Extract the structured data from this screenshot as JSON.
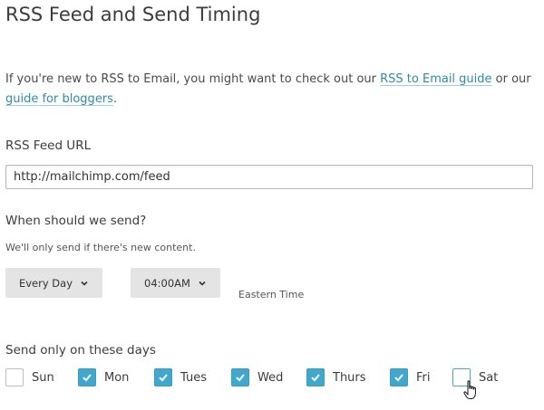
{
  "page": {
    "title": "RSS Feed and Send Timing"
  },
  "intro": {
    "text_before": "If you're new to RSS to Email, you might want to check out our ",
    "guide_link": "RSS to Email guide",
    "text_middle": " or our ",
    "bloggers_link": "guide for bloggers",
    "text_after": "."
  },
  "feed": {
    "label": "RSS Feed URL",
    "value": "http://mailchimp.com/feed"
  },
  "schedule": {
    "heading": "When should we send?",
    "note": "We'll only send if there's new content.",
    "frequency": "Every Day",
    "time": "04:00AM",
    "timezone": "Eastern Time"
  },
  "days": {
    "heading": "Send only on these days",
    "items": [
      {
        "label": "Sun",
        "checked": false
      },
      {
        "label": "Mon",
        "checked": true
      },
      {
        "label": "Tues",
        "checked": true
      },
      {
        "label": "Wed",
        "checked": true
      },
      {
        "label": "Thurs",
        "checked": true
      },
      {
        "label": "Fri",
        "checked": true
      },
      {
        "label": "Sat",
        "checked": false
      }
    ]
  },
  "colors": {
    "accent": "#40a8cc",
    "link": "#2f8ba8",
    "dropdown_bg": "#e4e4e4"
  },
  "icons": {
    "dropdown": "chevron-down-icon",
    "checked": "checkmark-icon",
    "cursor": "hand-pointer-icon"
  }
}
